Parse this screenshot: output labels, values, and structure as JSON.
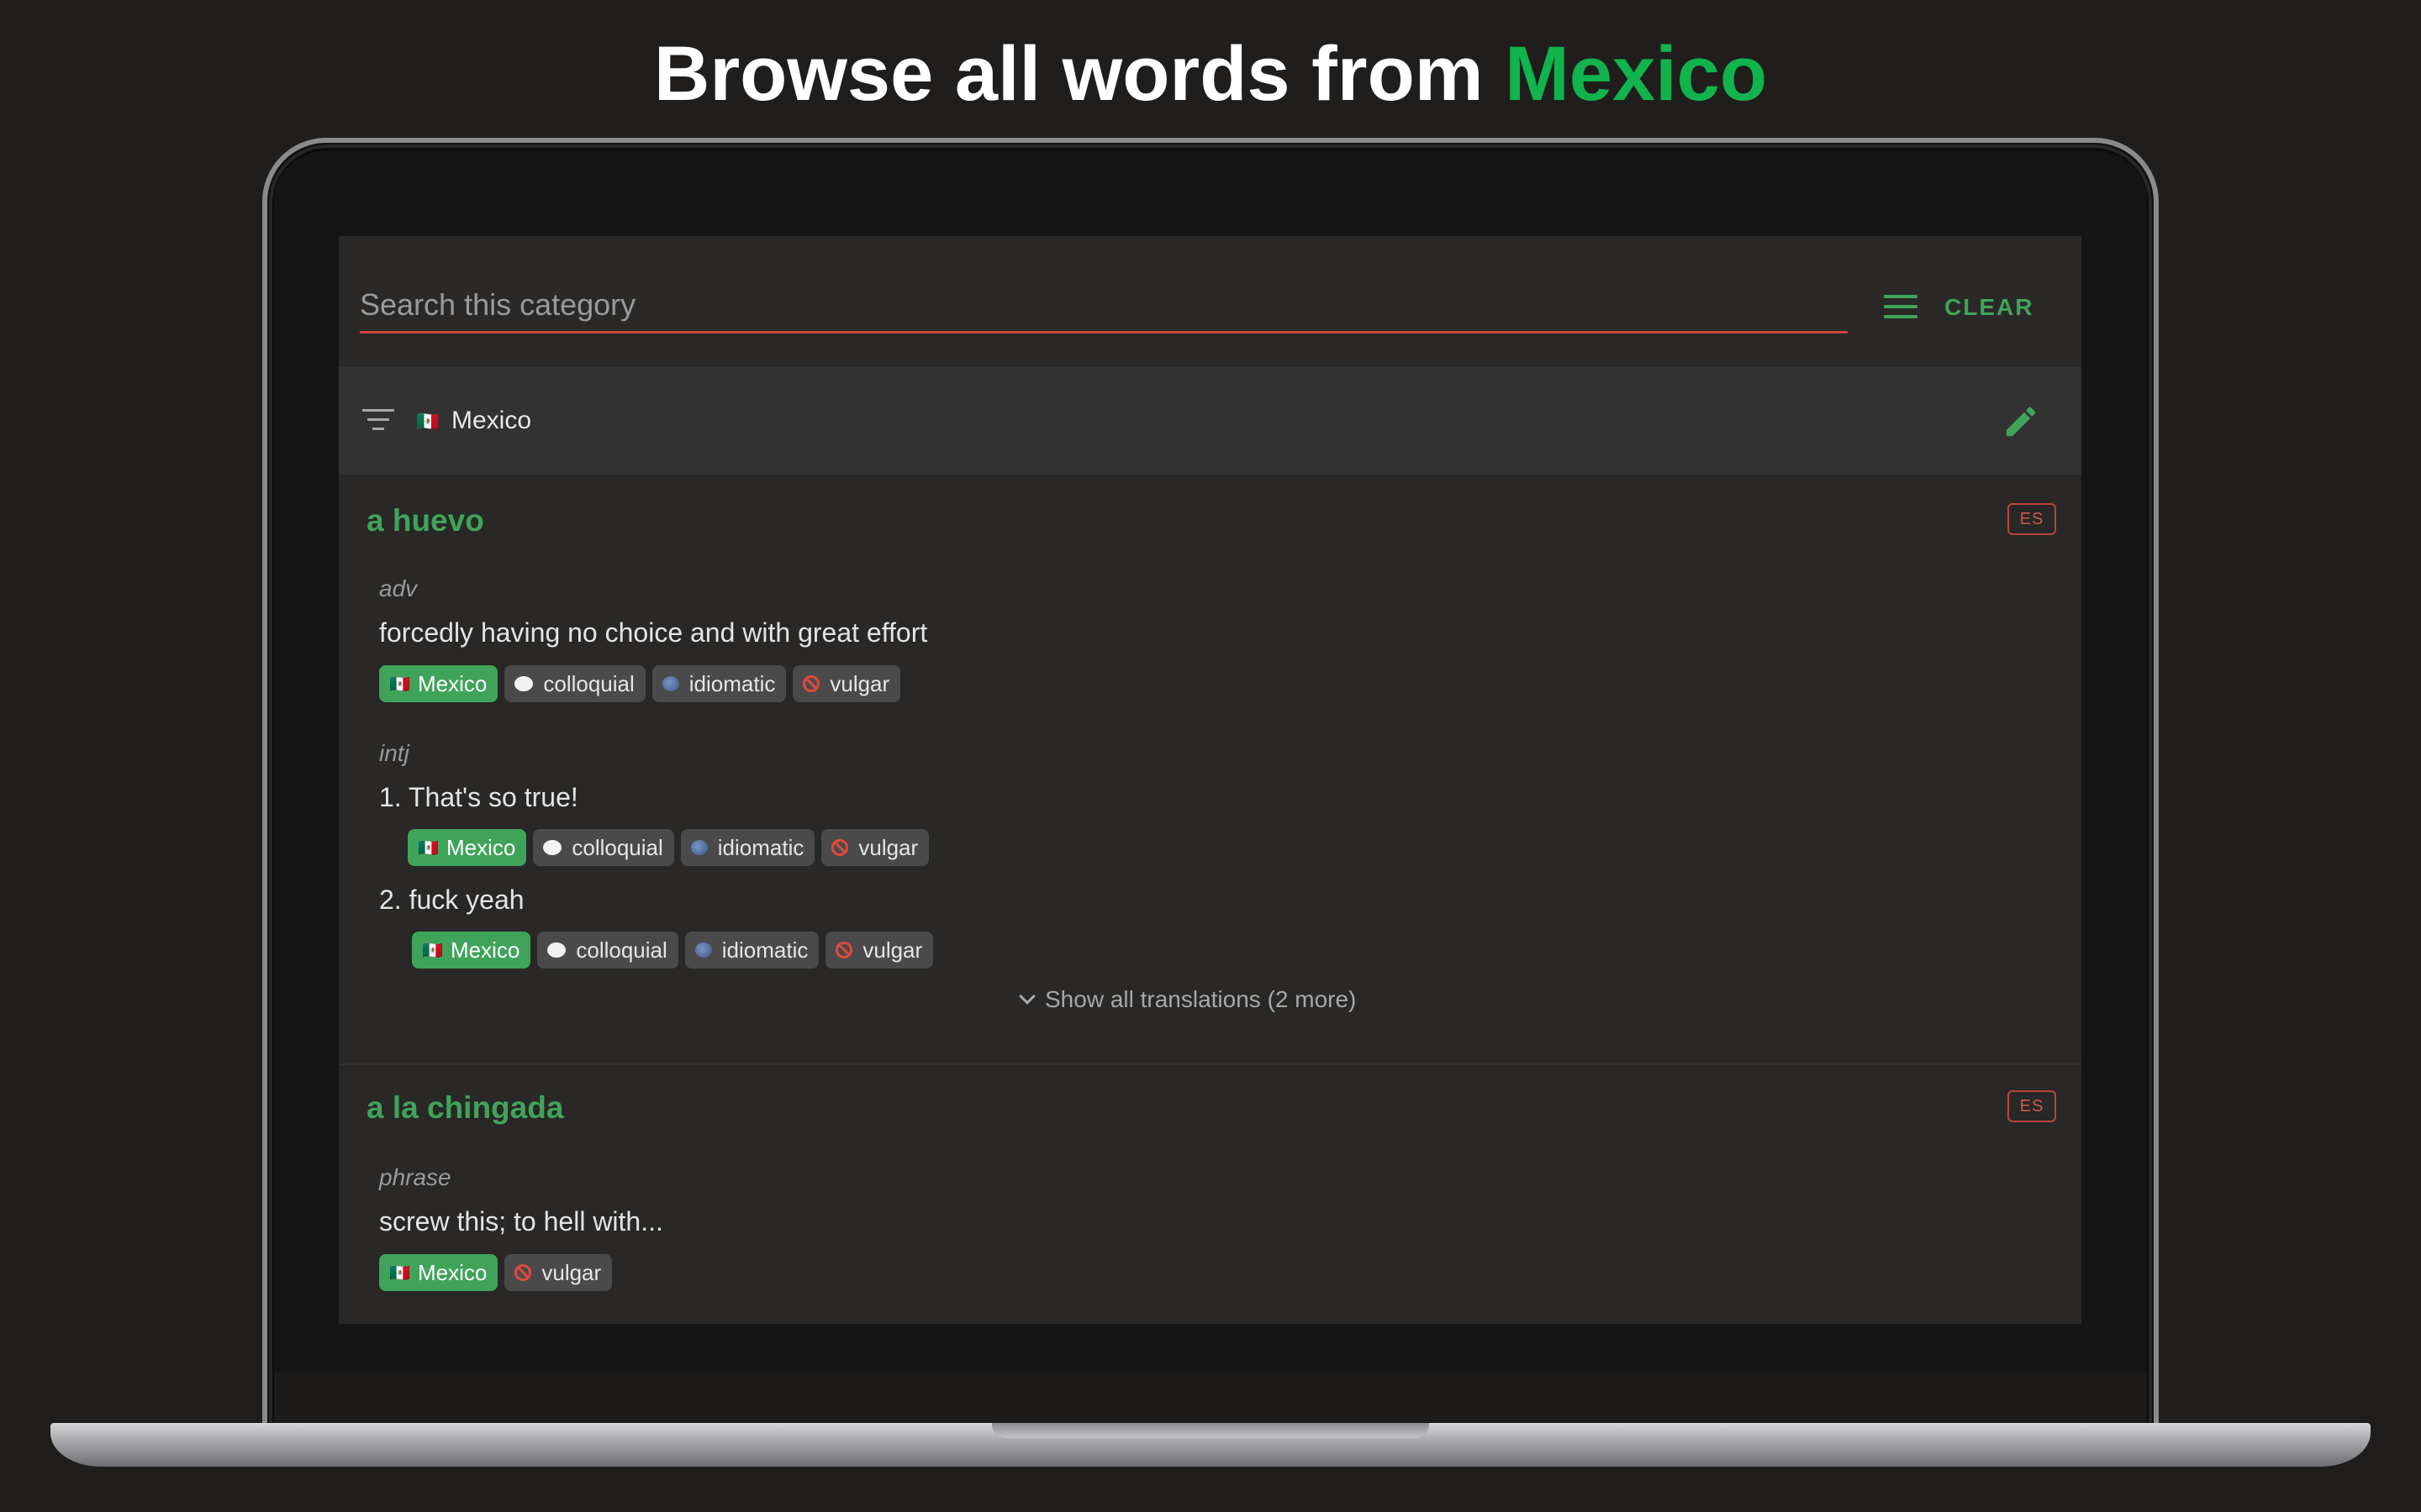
{
  "headline": {
    "text": "Browse all words from ",
    "accent": "Mexico"
  },
  "search": {
    "placeholder": "Search this category",
    "clear_label": "CLEAR"
  },
  "filter": {
    "label": "Mexico",
    "flag": "🇲🇽"
  },
  "colors": {
    "accent_green": "#3fa45a",
    "headline_green": "#10b34c",
    "badge_red": "#d0574c"
  },
  "entries": [
    {
      "word": "a huevo",
      "lang": "ES",
      "senses": [
        {
          "pos": "adv",
          "def": "forcedly having no choice and with great effort",
          "tags": [
            "Mexico",
            "colloquial",
            "idiomatic",
            "vulgar"
          ]
        },
        {
          "pos": "intj",
          "items": [
            {
              "def": "1. That's so true!",
              "tags": [
                "Mexico",
                "colloquial",
                "idiomatic",
                "vulgar"
              ]
            },
            {
              "def": "2. fuck yeah",
              "tags": [
                "Mexico",
                "colloquial",
                "idiomatic",
                "vulgar"
              ]
            }
          ]
        }
      ],
      "show_all": "Show all translations (2 more)"
    },
    {
      "word": "a la chingada",
      "lang": "ES",
      "senses": [
        {
          "pos": "phrase",
          "def": "screw this; to hell with...",
          "tags": [
            "Mexico",
            "vulgar"
          ]
        }
      ]
    }
  ]
}
